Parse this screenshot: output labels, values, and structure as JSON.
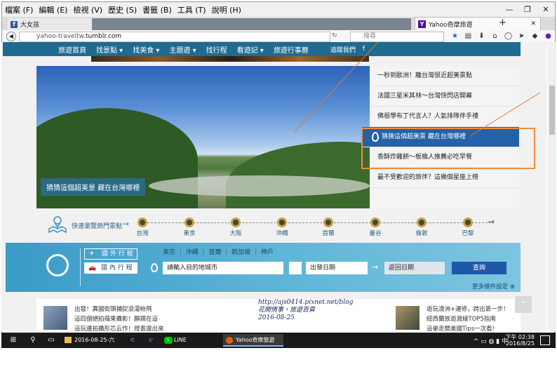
{
  "menu": [
    "檔案 (F)",
    "編輯 (E)",
    "檢視 (V)",
    "歷史 (S)",
    "書籤 (B)",
    "工具 (T)",
    "說明 (H)"
  ],
  "window_controls": [
    "—",
    "❐",
    "✕"
  ],
  "tabs": [
    {
      "label": "大女孩",
      "icon": "facebook-icon"
    },
    {
      "label": "Yahoo奇摩旅遊",
      "icon": "yahoo-icon"
    }
  ],
  "address": {
    "prefix": "yahoo-traveltw.",
    "domain": "tumblr.com"
  },
  "search_placeholder": "搜尋",
  "site_nav": {
    "items": [
      "旅遊首頁",
      "找景點 ▾",
      "找美食 ▾",
      "主題遊 ▾",
      "找行程",
      "看遊記 ▾",
      "旅遊行事曆"
    ],
    "follow": "追蹤我們",
    "fb": "f"
  },
  "hero": {
    "caption": "猜猜這個超美景 藏在台灣哪裡"
  },
  "side_list": [
    "一秒到歐洲！離台灣很近超美景點",
    "法國三星米其林～台灣快閃店開幕",
    "佛祖學布丁代言人？人氣排隊伴手禮",
    "猜猜這個超美景 藏在台灣哪裡",
    "香酥炸雞餅～板橋人推薦必吃早餐",
    "最不受歡迎的旅伴？這幾個星座上榜"
  ],
  "timeline": {
    "label": "快速瀏覽熱門景點",
    "stops": [
      "台灣",
      "東京",
      "大阪",
      "沖繩",
      "首爾",
      "曼谷",
      "倫敦",
      "巴黎"
    ]
  },
  "search_panel": {
    "tab_international": "國 外 行 程",
    "tab_domestic": "國 內 行 程",
    "cities": "東京 ｜ 沖繩 ｜ 首爾 ｜ 新加坡 ｜ 神戶",
    "destination_placeholder": "請輸入目的地城市",
    "depart_placeholder": "出發日期",
    "return_placeholder": "返回日期",
    "search_button": "查詢",
    "more_settings": "更多條件設定 ⊕"
  },
  "bottom": {
    "left_lines": [
      "出發！異國街頭捕捉浪漫紛飛",
      "這四個絕拍蘋果攝影！願親在這",
      "這玩邊拍攝形芯云作！證書還出來"
    ],
    "watermark": [
      "http://ajs0414.pixnet.net/blog",
      "花開情事‧旅遊百頁",
      "2016-08-25"
    ],
    "right_lines": [
      "遊玩澳洲+運修，跨出第一步！",
      "紐西蘭放遊渡線TOP5指南",
      "這擧走開美國Tips一次看！"
    ]
  },
  "taskbar": {
    "items": [
      "2016-08-25-六十...",
      "LINE",
      "Yahoo奇摩旅遊 -..."
    ],
    "time": "下午 02:38",
    "date": "2016/8/25"
  }
}
